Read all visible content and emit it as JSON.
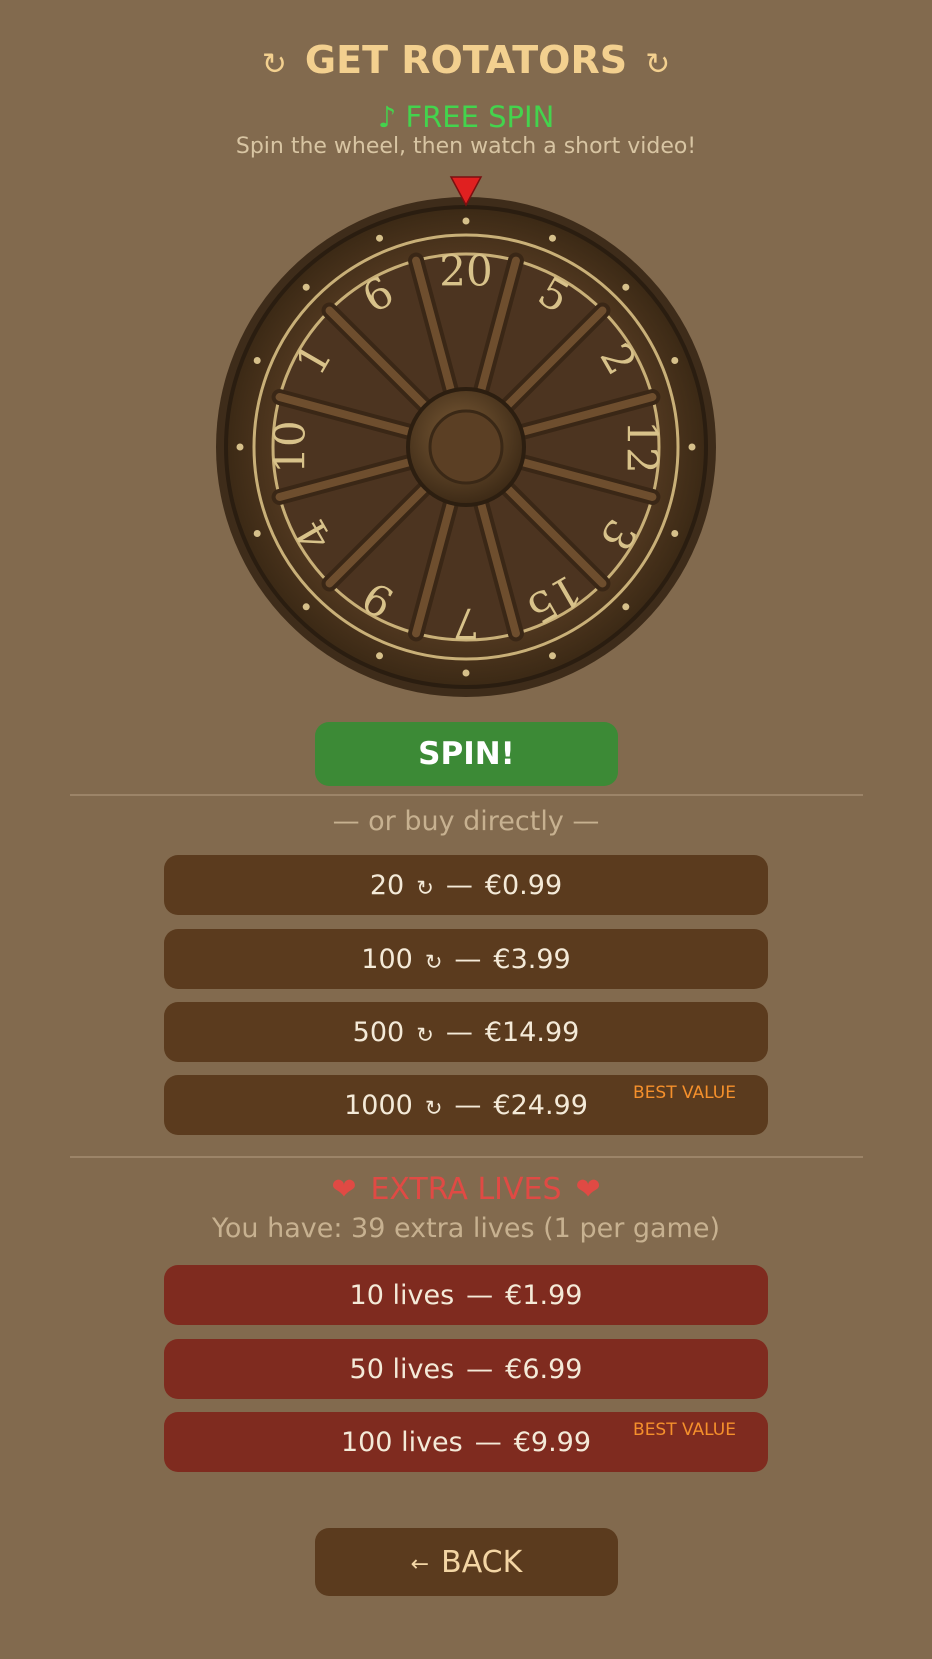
{
  "header": {
    "title": "GET ROTATORS",
    "rotator_glyph": "↻"
  },
  "free_spin": {
    "icon": "♪",
    "label": "FREE SPIN",
    "hint": "Spin the wheel, then watch a short video!"
  },
  "wheel": {
    "segments": [
      "20",
      "5",
      "2",
      "12",
      "3",
      "15",
      "7",
      "9",
      "4",
      "10",
      "1",
      "6"
    ],
    "pointer_color": "#e02020"
  },
  "spin_button": {
    "label": "SPIN!"
  },
  "buy_section": {
    "heading": "— or buy directly —",
    "packs": [
      {
        "amount": "20",
        "separator": "—",
        "price": "€0.99",
        "badge": ""
      },
      {
        "amount": "100",
        "separator": "—",
        "price": "€3.99",
        "badge": ""
      },
      {
        "amount": "500",
        "separator": "—",
        "price": "€14.99",
        "badge": ""
      },
      {
        "amount": "1000",
        "separator": "—",
        "price": "€24.99",
        "badge": "BEST VALUE"
      }
    ]
  },
  "lives_section": {
    "heart": "❤",
    "title": "EXTRA LIVES",
    "status": "You have: 39 extra lives  (1 per game)",
    "packs": [
      {
        "label": "10 lives",
        "separator": "—",
        "price": "€1.99",
        "badge": ""
      },
      {
        "label": "50 lives",
        "separator": "—",
        "price": "€6.99",
        "badge": ""
      },
      {
        "label": "100 lives",
        "separator": "—",
        "price": "€9.99",
        "badge": "BEST VALUE"
      }
    ]
  },
  "back_button": {
    "arrow": "←",
    "label": "BACK"
  },
  "colors": {
    "background": "#826a4e",
    "title": "#f3d08f",
    "free_spin": "#44d34d",
    "spin_button": "#3c8a36",
    "shop_button": "#5b3b1e",
    "lives_button": "#7f2b1f",
    "best_value": "#f5902c",
    "extra_lives": "#e04a44"
  }
}
